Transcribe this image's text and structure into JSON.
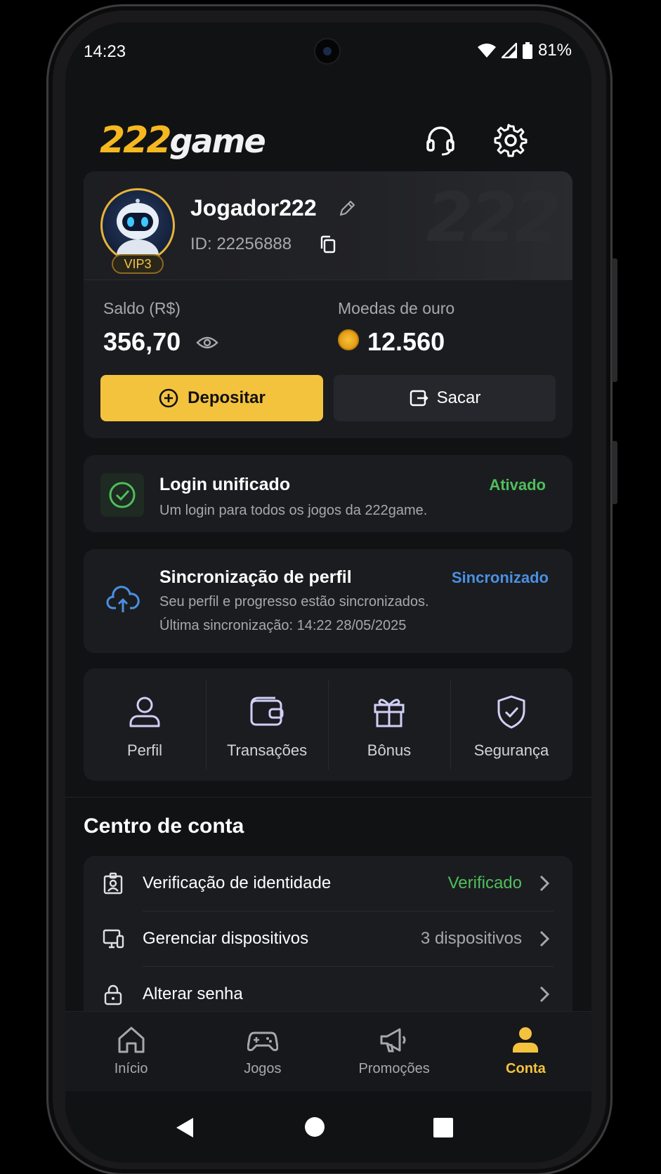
{
  "status_bar": {
    "time": "14:23",
    "battery": "81%"
  },
  "header": {
    "logo_number": "222",
    "logo_text": "game"
  },
  "profile": {
    "username": "Jogador222",
    "id": "ID: 22256888",
    "vip": "VIP3",
    "watermark": "222",
    "balance_label": "Saldo (R$)",
    "balance_value": "356,70",
    "coins_label": "Moedas de ouro",
    "coins_value": "12.560",
    "deposit_label": "Depositar",
    "withdraw_label": "Sacar"
  },
  "login": {
    "title": "Login unificado",
    "subtitle": "Um login para todos os jogos da 222game.",
    "status": "Ativado"
  },
  "sync": {
    "title": "Sincronização de perfil",
    "subtitle": "Seu perfil e progresso estão sincronizados.",
    "last_sync": "Última sincronização: 14:22 28/05/2025",
    "status": "Sincronizado"
  },
  "quick_actions": [
    {
      "label": "Perfil"
    },
    {
      "label": "Transações"
    },
    {
      "label": "Bônus"
    },
    {
      "label": "Segurança"
    }
  ],
  "account_center": {
    "title": "Centro de conta",
    "items": [
      {
        "label": "Verificação de identidade",
        "value": "Verificado"
      },
      {
        "label": "Gerenciar dispositivos",
        "value": "3 dispositivos"
      },
      {
        "label": "Alterar senha",
        "value": ""
      }
    ]
  },
  "bottom_nav": [
    {
      "label": "Início"
    },
    {
      "label": "Jogos"
    },
    {
      "label": "Promoções"
    },
    {
      "label": "Conta"
    }
  ],
  "colors": {
    "accent": "#f4c33e",
    "success": "#4fbe5c",
    "info": "#4a90e2",
    "background": "#111214",
    "card": "#1b1c20"
  }
}
